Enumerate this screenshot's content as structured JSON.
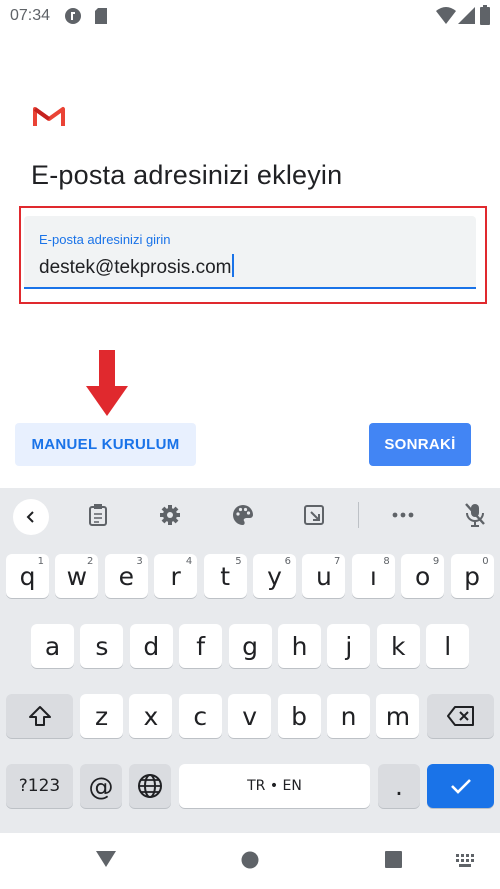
{
  "status_bar": {
    "time": "07:34",
    "icons": [
      "vpn-key-icon",
      "sd-card-icon",
      "wifi-icon",
      "signal-icon",
      "battery-icon"
    ]
  },
  "app": {
    "logo": "gmail-logo",
    "title": "E-posta adresinizi ekleyin"
  },
  "email_field": {
    "label": "E-posta adresinizi girin",
    "value": "destek@tekprosis.com"
  },
  "buttons": {
    "manual": "MANUEL KURULUM",
    "next": "SONRAKİ"
  },
  "annotation": {
    "highlight_color": "#e0292e",
    "arrow_color": "#e0292e"
  },
  "keyboard": {
    "toolbar": [
      "back-chevron-icon",
      "clipboard-icon",
      "settings-gear-icon",
      "palette-icon",
      "floating-keyboard-icon",
      "more-dots-icon",
      "mic-off-icon"
    ],
    "row1": [
      {
        "k": "q",
        "h": "1"
      },
      {
        "k": "w",
        "h": "2"
      },
      {
        "k": "e",
        "h": "3"
      },
      {
        "k": "r",
        "h": "4"
      },
      {
        "k": "t",
        "h": "5"
      },
      {
        "k": "y",
        "h": "6"
      },
      {
        "k": "u",
        "h": "7"
      },
      {
        "k": "ı",
        "h": "8"
      },
      {
        "k": "o",
        "h": "9"
      },
      {
        "k": "p",
        "h": "0"
      }
    ],
    "row2": [
      "a",
      "s",
      "d",
      "f",
      "g",
      "h",
      "j",
      "k",
      "l"
    ],
    "row3": [
      "z",
      "x",
      "c",
      "v",
      "b",
      "n",
      "m"
    ],
    "symbols": "?123",
    "at": "@",
    "space": "TR • EN",
    "period": ".",
    "accent": "#1a73e8"
  },
  "nav_bar": [
    "back-triangle-icon",
    "home-circle-icon",
    "recents-square-icon",
    "keyboard-switch-icon"
  ]
}
